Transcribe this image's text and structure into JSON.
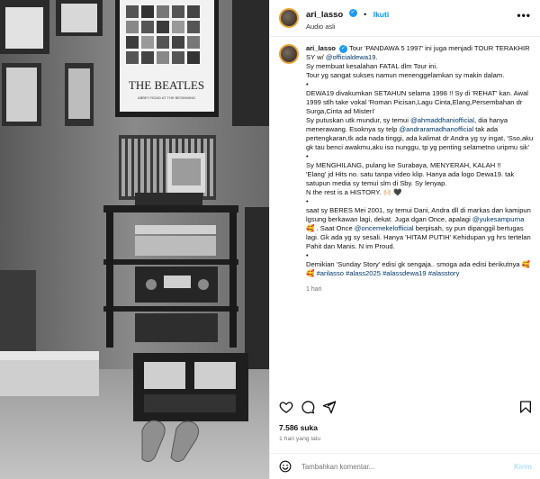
{
  "post": {
    "username": "ari_lasso",
    "follow_label": "Ikuti",
    "audio_label": "Audio asli",
    "more_label": "•••"
  },
  "photo": {
    "poster_title": "THE BEATLES",
    "poster_subtitle": "ABBEY ROAD AT THE BEGINNING"
  },
  "caption": {
    "lines": [
      {
        "parts": [
          {
            "t": "ari_lasso",
            "k": "uname"
          },
          {
            "t": " ",
            "k": ""
          },
          {
            "t": "✔",
            "k": "v"
          },
          {
            "t": " Tour 'PANDAWA 5 1997' ini juga menjadi TOUR TERAKHIR SY w/ ",
            "k": ""
          },
          {
            "t": "@officialdewa19",
            "k": "tag"
          },
          {
            "t": ".",
            "k": ""
          }
        ]
      },
      {
        "parts": [
          {
            "t": "Sy membuat kesalahan FATAL dlm Tour ini.",
            "k": ""
          }
        ]
      },
      {
        "parts": [
          {
            "t": "Tour yg sangat sukses namun menenggelamkan sy makin dalam.",
            "k": ""
          }
        ]
      },
      {
        "parts": [
          {
            "t": "•",
            "k": ""
          }
        ]
      },
      {
        "parts": [
          {
            "t": "DEWA19 divakumkan SETAHUN selama 1998 !! Sy di 'REHAT' kan. Awal 1999 stlh take vokal 'Roman Picisan,Lagu Cinta,Elang,Persembahan dr Surga,Cinta ad Misteri'",
            "k": ""
          }
        ]
      },
      {
        "parts": [
          {
            "t": "Sy putuskan utk mundur, sy temui ",
            "k": ""
          },
          {
            "t": "@ahmaddhaniofficial",
            "k": "tag"
          },
          {
            "t": ", dia hanya menerawang. Esoknya sy telp ",
            "k": ""
          },
          {
            "t": "@andraramadhanofficial",
            "k": "tag"
          },
          {
            "t": " tak ada pertengkaran,tk ada nada tinggi, ada kalimat dr Andra yg sy ingat, 'Sso,aku gk tau benci awakmu,aku iso nunggu, tp yg penting selametno uripmu sik'",
            "k": ""
          }
        ]
      },
      {
        "parts": [
          {
            "t": "•",
            "k": ""
          }
        ]
      },
      {
        "parts": [
          {
            "t": "Sy MENGHILANG, pulang ke Surabaya, MENYERAH, KALAH !!",
            "k": ""
          }
        ]
      },
      {
        "parts": [
          {
            "t": "'Elang' jd Hits no. satu tanpa video klip. Hanya ada logo Dewa19. tak satupun media sy temui slm di Sby. Sy lenyap.",
            "k": ""
          }
        ]
      },
      {
        "parts": [
          {
            "t": "N the rest is a HISTORY. 🙌🏻 🖤",
            "k": ""
          }
        ]
      },
      {
        "parts": [
          {
            "t": "•",
            "k": ""
          }
        ]
      },
      {
        "parts": [
          {
            "t": "saat sy BERES Mei 2001, sy temui Dani, Andra dll di markas dan kamipun lgsung berkawan lagi, dekat. Juga dgan Once, apalagi ",
            "k": ""
          },
          {
            "t": "@yukesampurna",
            "k": "tag"
          },
          {
            "t": " 🥰 . Saat Once ",
            "k": ""
          },
          {
            "t": "@oncemekelofficial",
            "k": "tag"
          },
          {
            "t": " berpisah, sy pun dipanggil bertugas lagi. Gk ada yg sy sesali. Hanya 'HITAM PUTIH' Kehidupan yg hrs tertelan Pahit dan Manis. N im Proud.",
            "k": ""
          }
        ]
      },
      {
        "parts": [
          {
            "t": "•",
            "k": ""
          }
        ]
      },
      {
        "parts": [
          {
            "t": "Demikian 'Sunday Story' edisi gk sengaja.. smoga ada edisi berikutnya 🥰 🥰 ",
            "k": ""
          },
          {
            "t": "#arilasso",
            "k": "tag"
          },
          {
            "t": " ",
            "k": ""
          },
          {
            "t": "#alass2025",
            "k": "tag"
          },
          {
            "t": " ",
            "k": ""
          },
          {
            "t": "#alassdewa19",
            "k": "tag"
          },
          {
            "t": " ",
            "k": ""
          },
          {
            "t": "#alasstory",
            "k": "tag"
          }
        ]
      }
    ],
    "time_ago": "1 hari"
  },
  "stats": {
    "likes": "7.586 suka",
    "posted": "1 hari yang lalu"
  },
  "comment": {
    "placeholder": "Tambahkan komentar...",
    "send_label": "Kirim"
  },
  "colors": {
    "link": "#00376b",
    "follow": "#0095f6",
    "verified": "#1d9bf0",
    "story_ring": "#e8a23a"
  },
  "icons": [
    "heart-icon",
    "comment-icon",
    "share-icon",
    "bookmark-icon",
    "emoji-icon",
    "more-icon",
    "verified-icon"
  ]
}
